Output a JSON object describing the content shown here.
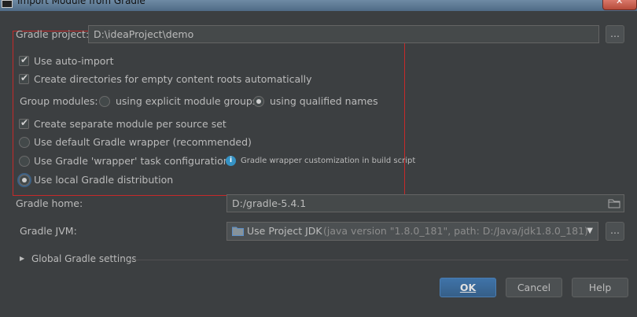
{
  "window": {
    "title": "Import Module from Gradle",
    "close_glyph": "✕"
  },
  "project": {
    "label": "Gradle project:",
    "value": "D:\\ideaProject\\demo",
    "browse_label": "..."
  },
  "options": {
    "auto_import": {
      "label": "Use auto-import",
      "checked": true
    },
    "create_dirs": {
      "label": "Create directories for empty content roots automatically",
      "checked": true
    },
    "group_modules": {
      "label": "Group modules:",
      "explicit": "using explicit module groups",
      "qualified": "using qualified names",
      "selected": "qualified"
    },
    "separate_module": {
      "label": "Create separate module per source set",
      "checked": true
    },
    "wrapper_choice": {
      "default_wrapper": "Use default Gradle wrapper (recommended)",
      "wrapper_task": "Use Gradle 'wrapper' task configuration",
      "wrapper_hint": "Gradle wrapper customization in build script",
      "local_dist": "Use local Gradle distribution",
      "selected": "local_dist"
    }
  },
  "gradle_home": {
    "label": "Gradle home:",
    "value": "D:/gradle-5.4.1"
  },
  "gradle_jvm": {
    "label": "Gradle JVM:",
    "value": "Use Project JDK",
    "detail": "(java version \"1.8.0_181\", path: D:/Java/jdk1.8.0_181)",
    "browse_label": "..."
  },
  "global_settings": {
    "label": "Global Gradle settings",
    "expanded": false
  },
  "buttons": {
    "ok": "OK",
    "cancel": "Cancel",
    "help": "Help"
  },
  "icons": {
    "checkmark": "✔",
    "info": "i",
    "arrow_right": "▶",
    "arrow_down": "▼"
  },
  "colors": {
    "background": "#3c3f41",
    "accent": "#365f88",
    "highlight_border": "#c62a2a",
    "info": "#3592c4"
  }
}
